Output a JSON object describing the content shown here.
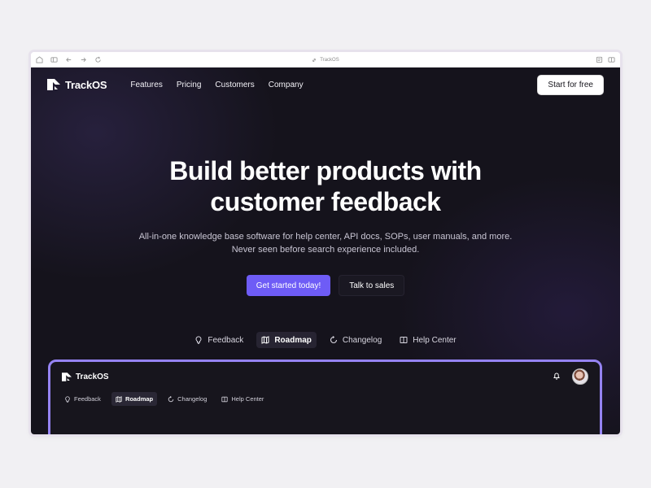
{
  "browser": {
    "address": "TrackOS",
    "icons": [
      "shield-icon",
      "sidebar-icon",
      "back-arrow-icon",
      "forward-arrow-icon",
      "reload-icon",
      "link-icon",
      "reader-icon",
      "split-view-icon"
    ]
  },
  "nav": {
    "brand": "TrackOS",
    "links": [
      "Features",
      "Pricing",
      "Customers",
      "Company"
    ],
    "cta": "Start for free"
  },
  "hero": {
    "title_line1": "Build better products with",
    "title_line2": "customer feedback",
    "subtitle_line1": "All-in-one knowledge base software for help center, API docs, SOPs, user manuals, and more.",
    "subtitle_line2": "Never seen before search experience included.",
    "primary_cta": "Get started today!",
    "secondary_cta": "Talk to sales"
  },
  "tabs": [
    {
      "label": "Feedback",
      "icon": "lightbulb-icon",
      "active": false
    },
    {
      "label": "Roadmap",
      "icon": "map-icon",
      "active": true
    },
    {
      "label": "Changelog",
      "icon": "changelog-icon",
      "active": false
    },
    {
      "label": "Help Center",
      "icon": "book-icon",
      "active": false
    }
  ],
  "preview": {
    "brand": "TrackOS",
    "tabs": [
      {
        "label": "Feedback",
        "active": false
      },
      {
        "label": "Roadmap",
        "active": true
      },
      {
        "label": "Changelog",
        "active": false
      },
      {
        "label": "Help Center",
        "active": false
      }
    ]
  },
  "colors": {
    "accent": "#6e5cf6",
    "background": "#15131c",
    "preview_border": "#9583f2"
  }
}
